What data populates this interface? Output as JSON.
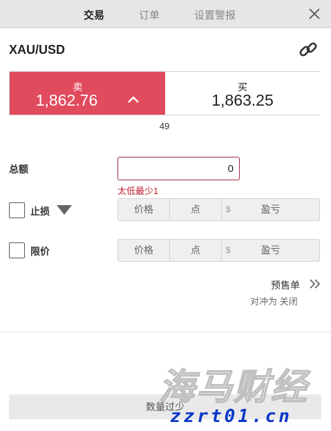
{
  "header": {
    "tabs": [
      {
        "label": "交易",
        "active": true
      },
      {
        "label": "订单",
        "active": false
      },
      {
        "label": "设置警报",
        "active": false
      }
    ],
    "close_icon": "close-icon"
  },
  "instrument": {
    "symbol": "XAU/USD",
    "link_icon": "link-icon"
  },
  "quote": {
    "sell_label": "卖",
    "sell_price": "1,862.76",
    "sell_trend_icon": "chevron-up-icon",
    "buy_label": "买",
    "buy_price": "1,863.25",
    "spread": "49"
  },
  "amount": {
    "label": "总额",
    "value": "0",
    "error": "太低最少1"
  },
  "stop_loss": {
    "label": "止损",
    "dropdown_icon": "triangle-down-icon",
    "price": "价格",
    "points": "点",
    "currency": "$",
    "pnl": "盈亏"
  },
  "limit": {
    "label": "限价",
    "price": "价格",
    "points": "点",
    "currency": "$",
    "pnl": "盈亏"
  },
  "preorder": {
    "label": "预售单",
    "icon": "double-chevron-right-icon",
    "hedge": "对冲为 关闭"
  },
  "submit": {
    "label": "数量过少"
  },
  "watermark": {
    "text": "海马财经",
    "url": "zzrt01.cn"
  },
  "colors": {
    "sell": "#e04b5e",
    "error": "#c0202f",
    "input_border": "#9b2a3a",
    "watermark_url": "#0a38c9"
  }
}
